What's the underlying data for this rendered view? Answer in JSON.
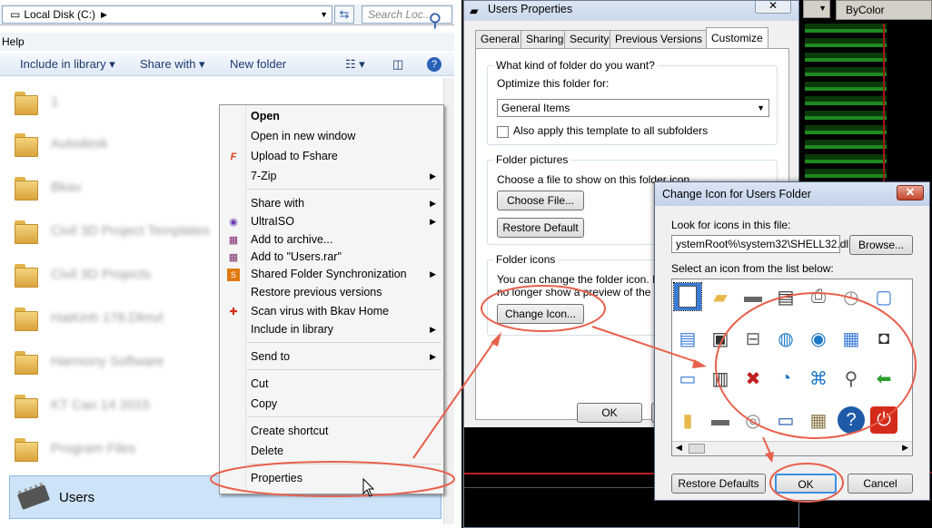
{
  "explorer": {
    "address": "Local Disk (C:)",
    "search_placeholder": "Search Loc...",
    "menu": "Help",
    "toolbar": {
      "include": "Include in library",
      "share": "Share with",
      "new_folder": "New folder"
    },
    "selected_item": "Users"
  },
  "context_menu": {
    "items": [
      "Open",
      "Open in new window",
      "Upload to Fshare",
      "7-Zip",
      "Share with",
      "UltraISO",
      "Add to archive...",
      "Add to \"Users.rar\"",
      "Shared Folder Synchronization",
      "Restore previous versions",
      "Scan virus with Bkav Home",
      "Include in library",
      "Send to",
      "Cut",
      "Copy",
      "Create shortcut",
      "Delete",
      "Properties"
    ]
  },
  "properties": {
    "title": "Users Properties",
    "tabs": [
      "General",
      "Sharing",
      "Security",
      "Previous Versions",
      "Customize"
    ],
    "q1": "What kind of folder do you want?",
    "optimize_label": "Optimize this folder for:",
    "optimize_value": "General Items",
    "apply_template": "Also apply this template to all subfolders",
    "folder_pictures": "Folder pictures",
    "choose_text": "Choose a file to show on this folder icon.",
    "choose_file": "Choose File...",
    "restore_default": "Restore Default",
    "folder_icons": "Folder icons",
    "icons_text1": "You can change the folder icon. If yo",
    "icons_text2": "no longer show a preview of the folde",
    "change_icon": "Change Icon...",
    "ok": "OK"
  },
  "background": {
    "bycolor": "ByColor"
  },
  "change_icon": {
    "title": "Change Icon for Users Folder",
    "look_label": "Look for icons in this file:",
    "path": "ystemRoot%\\system32\\SHELL32.dll",
    "browse": "Browse...",
    "select_label": "Select an icon from the list below:",
    "restore_defaults": "Restore Defaults",
    "ok": "OK",
    "cancel": "Cancel"
  }
}
